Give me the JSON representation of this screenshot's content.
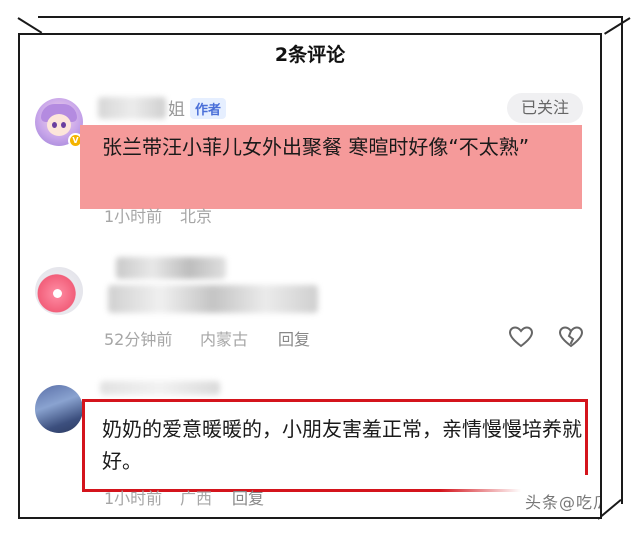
{
  "header": {
    "title": "2条评论"
  },
  "comments": [
    {
      "name_visible": "姐",
      "author_tag": "作者",
      "follow_label": "已关注",
      "text": "张兰带汪小菲儿女外出聚餐 寒暄时好像“不太熟”",
      "time": "1小时前",
      "location": "北京",
      "highlight_color": "#f59a9a"
    },
    {
      "time": "52分钟前",
      "location": "内蒙古",
      "reply_label": "回复"
    },
    {
      "text": "奶奶的爱意暖暖的，小朋友害羞正常，亲情慢慢培养就好。",
      "time": "1小时前",
      "location": "广西",
      "reply_label": "回复",
      "box_color": "#d4141c"
    }
  ],
  "icons": {
    "like": "heart-icon",
    "dislike": "broken-heart-icon",
    "verified": "verified-badge-icon"
  },
  "watermark": "头条@吃瓜小能手"
}
